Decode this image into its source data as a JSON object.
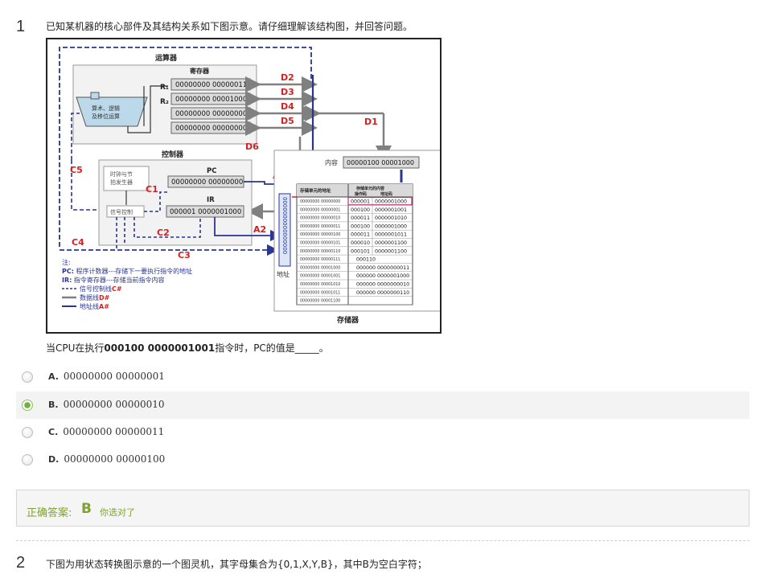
{
  "question1": {
    "number": "1",
    "text": "已知某机器的核心部件及其结构关系如下图示意。请仔细理解该结构图，并回答问题。",
    "figure": {
      "alu_title": "运算器",
      "reg_title": "寄存器",
      "r1": "R₁",
      "r2": "R₂",
      "reg_values": [
        "00000000 00000011",
        "00000000 00001000",
        "00000000 00000000",
        "00000000 00000000"
      ],
      "alu_unit": [
        "算术、逻辑",
        "及移位运算"
      ],
      "bus": {
        "D1": "D1",
        "D2": "D2",
        "D3": "D3",
        "D4": "D4",
        "D5": "D5",
        "D6": "D6",
        "A1": "A1",
        "A2": "A2",
        "C1": "C1",
        "C2": "C2",
        "C3": "C3",
        "C4": "C4",
        "C5": "C5"
      },
      "ctrl_title": "控制器",
      "clock": [
        "时钟与节",
        "拍发生器"
      ],
      "signal": "信号控制",
      "pc_label": "PC",
      "pc_value": "00000000 00000000",
      "ir_label": "IR",
      "ir_value": "000001 0000001000",
      "content_label": "内容",
      "content_value": "00000100 00001000",
      "addr_bits": "0000000000000000",
      "addr_label": "地址",
      "mem_title": "存储器",
      "mem_header_addr": "存储单元的地址",
      "mem_header_content": "存储单元的内容",
      "mem_header_op": "操作码",
      "mem_header_operand": "地址码",
      "mem_rows": [
        {
          "addr": "00000000 00000000",
          "op": "000001",
          "operand": "0000001000"
        },
        {
          "addr": "00000000 00000001",
          "op": "000100",
          "operand": "0000001001"
        },
        {
          "addr": "00000000 00000010",
          "op": "000011",
          "operand": "0000001010"
        },
        {
          "addr": "00000000 00000011",
          "op": "000100",
          "operand": "0000001000"
        },
        {
          "addr": "00000000 00000100",
          "op": "000011",
          "operand": "0000001011"
        },
        {
          "addr": "00000000 00000101",
          "op": "000010",
          "operand": "0000001100"
        },
        {
          "addr": "00000000 00000110",
          "op": "000101",
          "operand": "0000001100"
        },
        {
          "addr": "00000000 00000111",
          "op": "000110",
          "operand": ""
        },
        {
          "addr": "00000000 00001000",
          "op": "000000 0000000011",
          "operand": ""
        },
        {
          "addr": "00000000 00001001",
          "op": "000000 0000001000",
          "operand": ""
        },
        {
          "addr": "00000000 00001010",
          "op": "000000 0000000010",
          "operand": ""
        },
        {
          "addr": "00000000 00001011",
          "op": "000000 0000000110",
          "operand": ""
        },
        {
          "addr": "00000000 00001100",
          "op": "",
          "operand": ""
        }
      ],
      "legend": {
        "note": "注:",
        "pc_line_key": "PC:",
        "pc_line_text": " 程序计数器---存储下一要执行指令的地址",
        "ir_line_key": "IR:",
        "ir_line_text": " 指令寄存器---存储当前指令内容",
        "ctrl_text": "信号控制线",
        "ctrl_sym": "C#",
        "data_text": "数据线",
        "data_sym": "D#",
        "addr_text": "地址线",
        "addr_sym": "A#"
      }
    },
    "prompt_pre": "当CPU在执行",
    "prompt_bold": "000100 0000001001",
    "prompt_post": "指令时，PC的值是_____。",
    "options": [
      {
        "letter": "A.",
        "text": "00000000 00000001",
        "checked": false
      },
      {
        "letter": "B.",
        "text": "00000000 00000010",
        "checked": true
      },
      {
        "letter": "C.",
        "text": "00000000 00000011",
        "checked": false
      },
      {
        "letter": "D.",
        "text": "00000000 00000100",
        "checked": false
      }
    ],
    "answer_label": "正确答案:",
    "answer_letter": "B",
    "answer_note": "你选对了"
  },
  "question2": {
    "number": "2",
    "text": "下图为用状态转换图示意的一个图灵机，其字母集合为{0,1,X,Y,B}，其中B为空白字符；"
  },
  "colors": {
    "accent_green": "#7da32e",
    "radio_green": "#6fb33a",
    "bus_red": "#d42020",
    "bus_blue": "#2a3590"
  }
}
